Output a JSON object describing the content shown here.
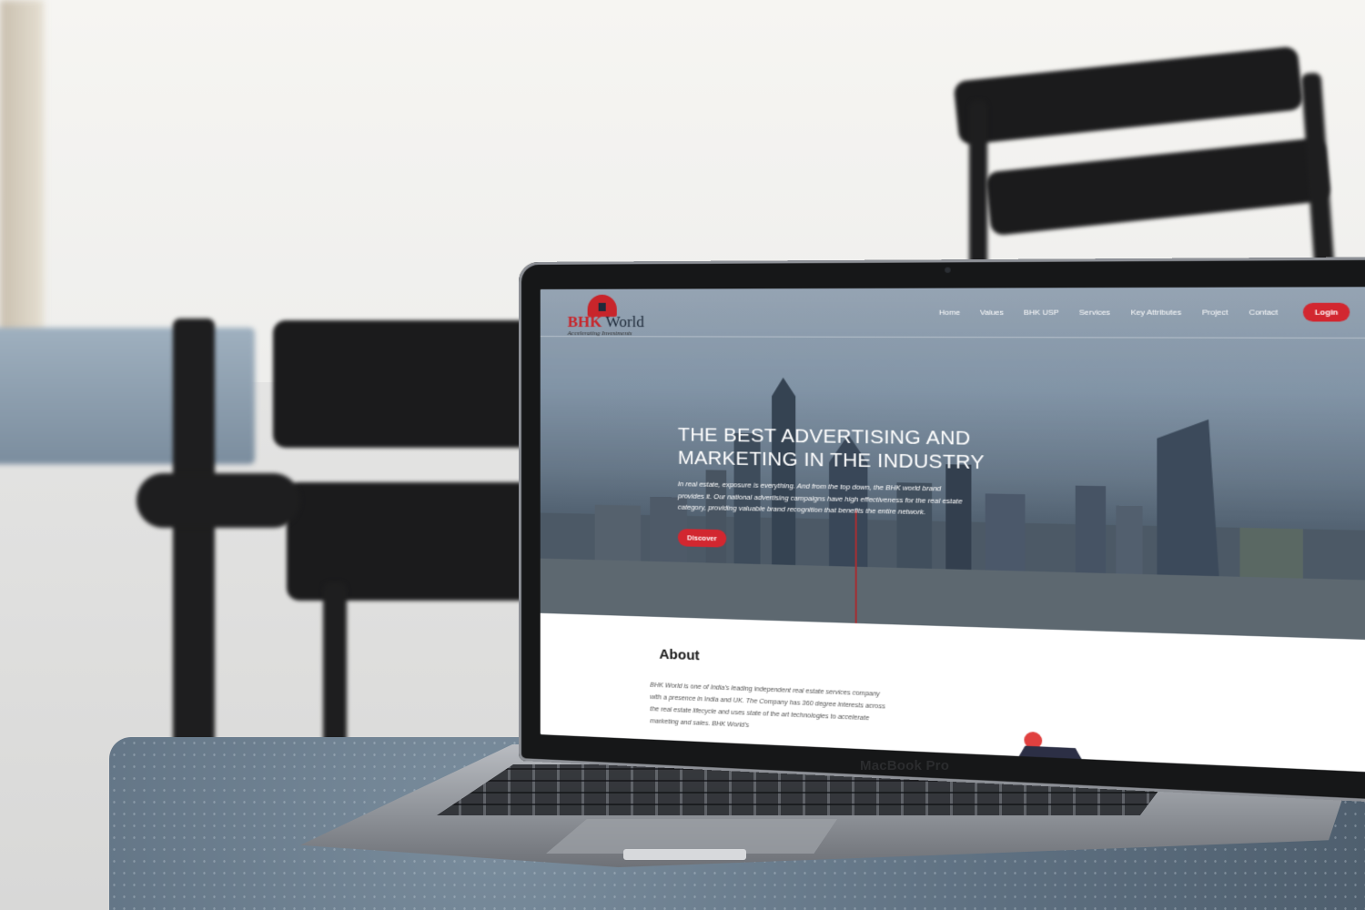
{
  "device": {
    "label": "MacBook Pro"
  },
  "site": {
    "logo": {
      "name_red": "BHK",
      "name_dark": " World",
      "tagline": "Accelerating Investments"
    },
    "nav": {
      "items": [
        "Home",
        "Values",
        "BHK USP",
        "Services",
        "Key Attributes",
        "Project",
        "Contact"
      ],
      "login_label": "Login"
    },
    "hero": {
      "title": "THE BEST ADVERTISING AND MARKETING IN THE INDUSTRY",
      "text": "In real estate, exposure is everything. And from the top down, the BHK world brand provides it. Our national advertising campaigns have high effectiveness for the real estate category, providing valuable brand recognition that benefits the entire network.",
      "cta_label": "Discover"
    },
    "about": {
      "title": "About",
      "text": "BHK World is one of India's leading independent real estate services company with a presence in India and UK. The Company has 360 degree interests across the real estate lifecycle and uses state of the art technologies to accelerate marketing and sales. BHK World's"
    }
  },
  "colors": {
    "accent": "#d22730",
    "logo_red": "#c8252b",
    "logo_dark": "#1e2a3a"
  }
}
